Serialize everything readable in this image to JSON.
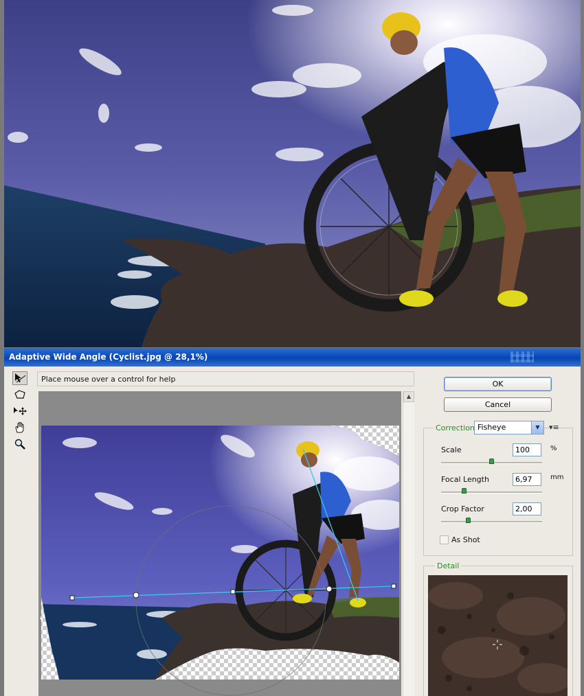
{
  "dialog": {
    "title": "Adaptive Wide Angle (Cyclist.jpg @ 28,1%)",
    "help_text": "Place mouse over a control for help",
    "ok_label": "OK",
    "cancel_label": "Cancel"
  },
  "tools": [
    {
      "name": "constraint-tool-icon",
      "glyph": "↖"
    },
    {
      "name": "polygon-constraint-tool-icon",
      "glyph": "⬠"
    },
    {
      "name": "move-tool-icon",
      "glyph": "▸✥"
    },
    {
      "name": "hand-tool-icon",
      "glyph": "✋"
    },
    {
      "name": "zoom-tool-icon",
      "glyph": "🔍"
    }
  ],
  "correction": {
    "label": "Correction:",
    "value": "Fisheye",
    "scale": {
      "label": "Scale",
      "value": "100",
      "unit": "%",
      "slider": 0.5
    },
    "focal_length": {
      "label": "Focal Length",
      "value": "6,97",
      "unit": "mm",
      "slider": 0.23
    },
    "crop_factor": {
      "label": "Crop Factor",
      "value": "2,00",
      "slider": 0.27
    },
    "as_shot": {
      "label": "As Shot",
      "checked": false
    }
  },
  "detail": {
    "label": "Detail"
  },
  "colors": {
    "accent": "#2a8a2a",
    "title_bar": "#0a47b4",
    "constraint_line": "#35c8e8"
  }
}
